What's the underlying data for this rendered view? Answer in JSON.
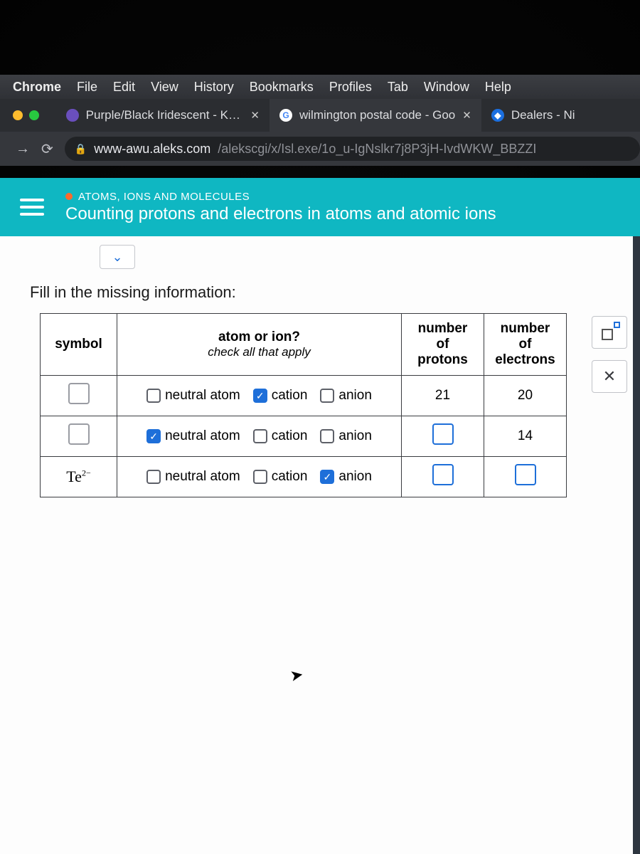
{
  "mac_menu": [
    "Chrome",
    "File",
    "Edit",
    "View",
    "History",
    "Bookmarks",
    "Profiles",
    "Tab",
    "Window",
    "Help"
  ],
  "tabs": [
    {
      "title": "Purple/Black Iridescent - KPM",
      "favicon": "purple",
      "active": false
    },
    {
      "title": "wilmington postal code - Goo",
      "favicon": "google",
      "active": true
    },
    {
      "title": "Dealers - Ni",
      "favicon": "blue",
      "active": false,
      "truncated": true
    }
  ],
  "address": {
    "host": "www-awu.aleks.com",
    "path": "/alekscgi/x/Isl.exe/1o_u-IgNslkr7j8P3jH-IvdWKW_BBZZI"
  },
  "topic": {
    "category": "ATOMS, IONS AND MOLECULES",
    "title": "Counting protons and electrons in atoms and atomic ions"
  },
  "prompt": "Fill in the missing information:",
  "headers": {
    "symbol": "symbol",
    "ion": "atom or ion?",
    "ion_sub": "check all that apply",
    "protons": "number of protons",
    "electrons": "number of electrons"
  },
  "option_labels": {
    "neutral": "neutral atom",
    "cation": "cation",
    "anion": "anion"
  },
  "rows": [
    {
      "symbol_input": true,
      "symbol_text": "",
      "neutral": false,
      "cation": true,
      "anion": false,
      "protons": "21",
      "electrons": "20",
      "protons_input": false,
      "electrons_input": false
    },
    {
      "symbol_input": true,
      "symbol_text": "",
      "neutral": true,
      "cation": false,
      "anion": false,
      "protons": "",
      "electrons": "14",
      "protons_input": true,
      "electrons_input": false
    },
    {
      "symbol_input": false,
      "symbol_text": "Te",
      "symbol_charge": "2−",
      "neutral": false,
      "cation": false,
      "anion": true,
      "protons": "",
      "electrons": "",
      "protons_input": true,
      "electrons_input": true
    }
  ]
}
